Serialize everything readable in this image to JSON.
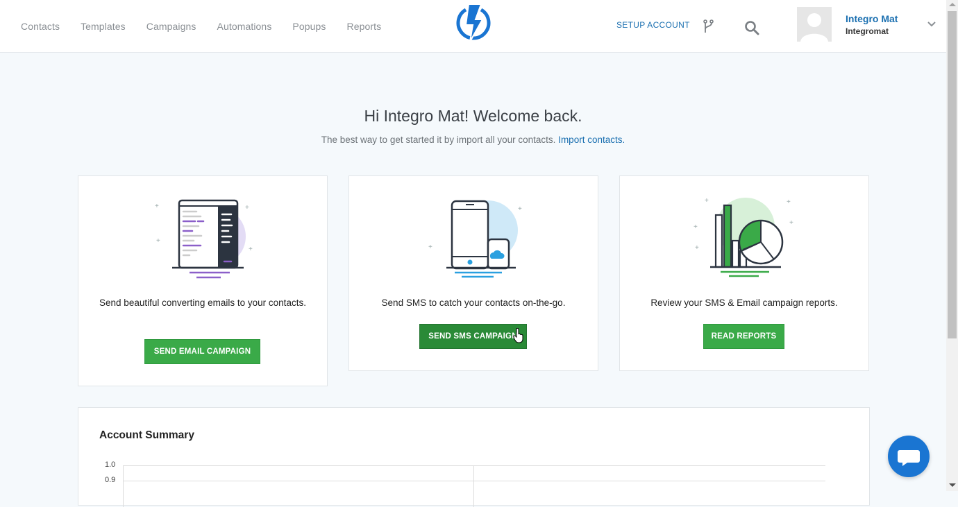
{
  "nav": {
    "items": [
      "Contacts",
      "Templates",
      "Campaigns",
      "Automations",
      "Popups",
      "Reports"
    ]
  },
  "header": {
    "setup_account": "SETUP ACCOUNT",
    "user_name": "Integro Mat",
    "user_org": "Integromat"
  },
  "welcome": {
    "title": "Hi Integro Mat! Welcome back.",
    "subtitle": "The best way to get started it by import all your contacts.",
    "import_link": "Import contacts."
  },
  "cards": [
    {
      "text": "Send beautiful converting emails to your contacts.",
      "button": "SEND EMAIL CAMPAIGN",
      "icon": "email-editor-illustration"
    },
    {
      "text": "Send SMS to catch your contacts on-the-go.",
      "button": "SEND SMS CAMPAIGN",
      "icon": "phone-sms-illustration"
    },
    {
      "text": "Review your SMS & Email campaign reports.",
      "button": "READ REPORTS",
      "icon": "reports-chart-illustration"
    }
  ],
  "summary": {
    "title": "Account Summary",
    "y_ticks": [
      "1.0",
      "0.9"
    ]
  },
  "colors": {
    "brand_blue": "#1a6fb0",
    "button_green": "#3aaa48",
    "button_green_hover": "#2a8a37",
    "chat_blue": "#1a75d2"
  }
}
